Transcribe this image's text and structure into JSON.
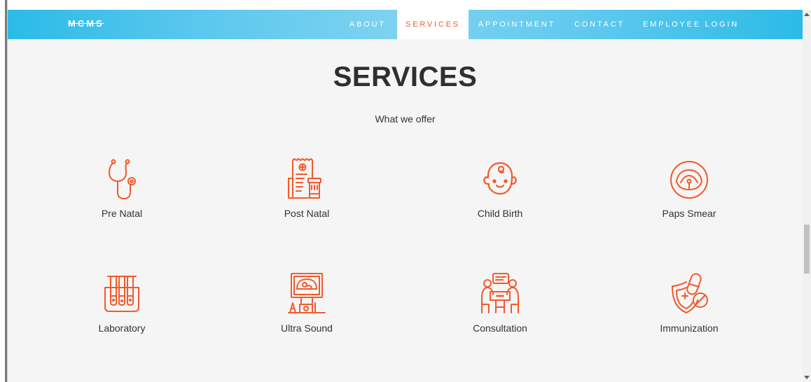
{
  "nav": {
    "brand": "MCMS",
    "items": [
      {
        "label": "ABOUT",
        "active": false
      },
      {
        "label": "SERVICES",
        "active": true
      },
      {
        "label": "APPOINTMENT",
        "active": false
      },
      {
        "label": "CONTACT",
        "active": false
      },
      {
        "label": "EMPLOYEE LOGIN",
        "active": false
      }
    ]
  },
  "section": {
    "title": "SERVICES",
    "subtitle": "What we offer"
  },
  "services": [
    {
      "label": "Pre Natal",
      "icon": "stethoscope-icon"
    },
    {
      "label": "Post Natal",
      "icon": "prescription-icon"
    },
    {
      "label": "Child Birth",
      "icon": "baby-icon"
    },
    {
      "label": "Paps Smear",
      "icon": "cervix-icon"
    },
    {
      "label": "Laboratory",
      "icon": "test-tubes-icon"
    },
    {
      "label": "Ultra Sound",
      "icon": "ultrasound-icon"
    },
    {
      "label": "Consultation",
      "icon": "consultation-icon"
    },
    {
      "label": "Immunization",
      "icon": "shield-pill-icon"
    }
  ],
  "colors": {
    "nav_gradient_edge": "#2bbbe7",
    "nav_gradient_center": "#7fd3f0",
    "accent": "#f15a2b",
    "background": "#f5f5f5",
    "text": "#333333"
  }
}
